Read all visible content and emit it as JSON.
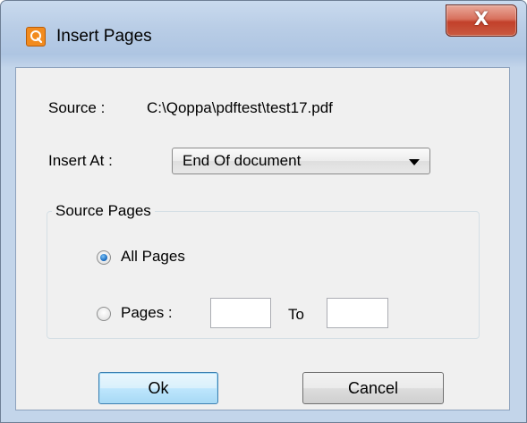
{
  "window": {
    "title": "Insert Pages",
    "close_glyph": "X",
    "app_icon": "qoppa-app-icon"
  },
  "form": {
    "source_label": "Source :",
    "source_value": "C:\\Qoppa\\pdftest\\test17.pdf",
    "insert_at_label": "Insert At :",
    "insert_at_value": "End Of document"
  },
  "source_pages": {
    "group_title": "Source Pages",
    "all_pages_label": "All Pages",
    "all_pages_selected": true,
    "pages_label": "Pages :",
    "pages_selected": false,
    "to_label": "To",
    "from_value": "",
    "to_value": ""
  },
  "buttons": {
    "ok": "Ok",
    "cancel": "Cancel"
  }
}
